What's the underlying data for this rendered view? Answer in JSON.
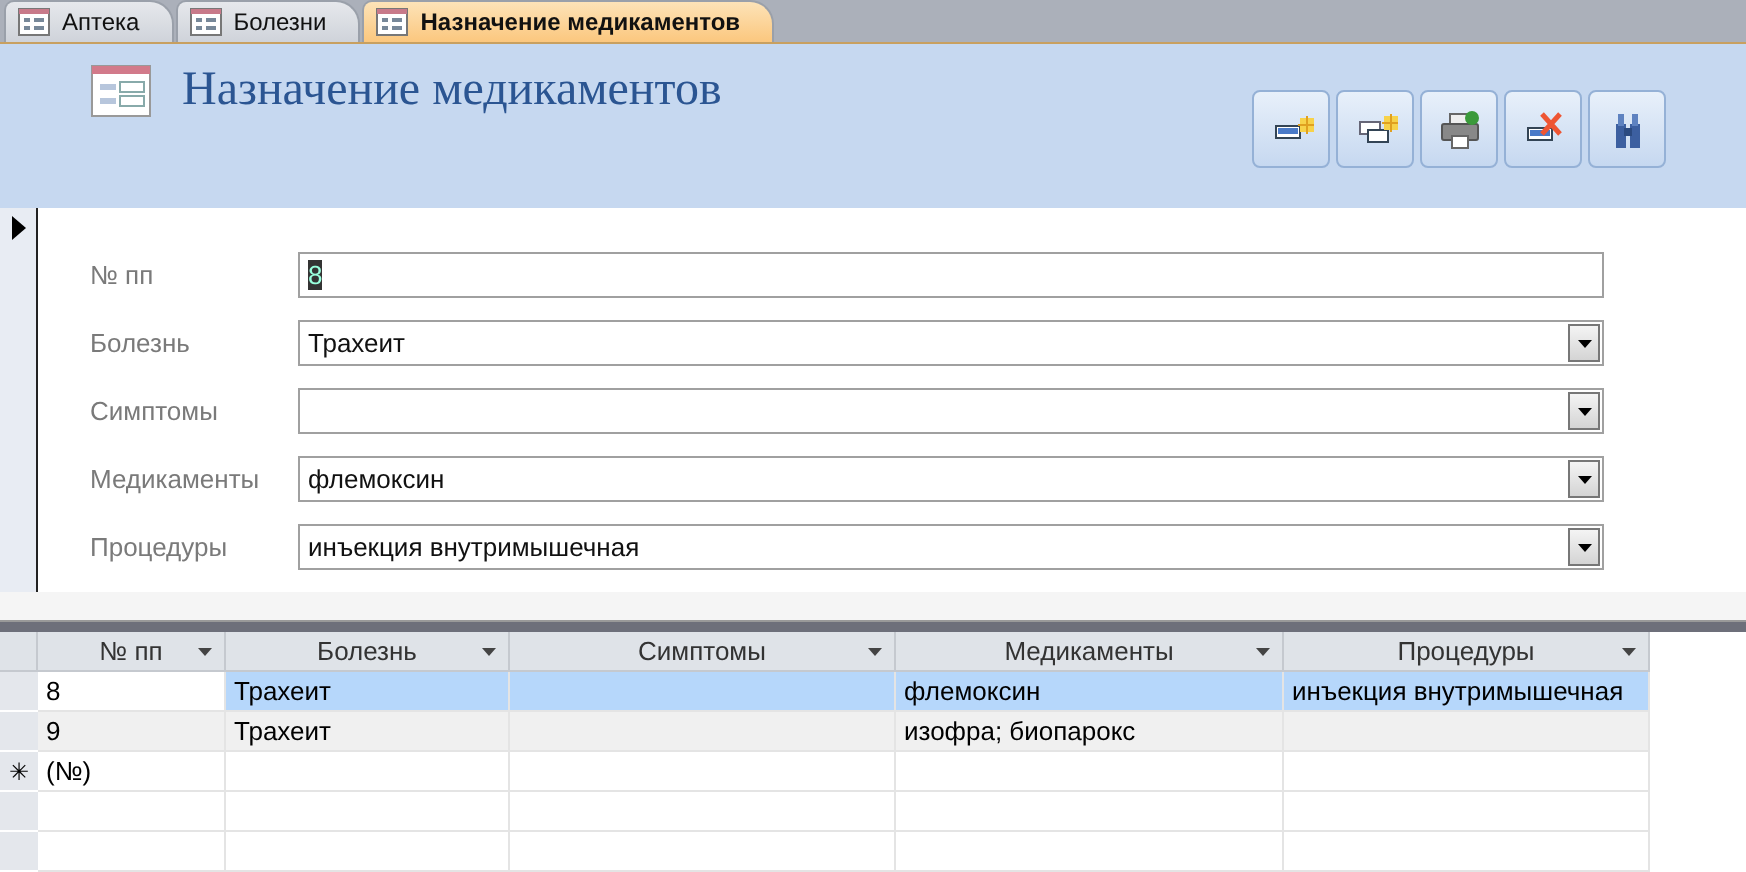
{
  "tabs": [
    {
      "label": "Аптека",
      "selected": false
    },
    {
      "label": "Болезни",
      "selected": false
    },
    {
      "label": "Назначение медикаментов",
      "selected": true
    }
  ],
  "form": {
    "title": "Назначение медикаментов",
    "current_record": true,
    "fields": [
      {
        "label": "№ пп",
        "value": "8",
        "kind": "text",
        "value_selected": true
      },
      {
        "label": "Болезнь",
        "value": "Трахеит",
        "kind": "combo"
      },
      {
        "label": "Симптомы",
        "kind": "combo"
      },
      {
        "label": "Медикаменты",
        "value": "флемоксин",
        "kind": "combo"
      },
      {
        "label": "Процедуры",
        "value": "инъекция внутримышечная",
        "kind": "combo"
      }
    ]
  },
  "table": {
    "columns": [
      "№ пп",
      "Болезнь",
      "Симптомы",
      "Медикаменты",
      "Процедуры"
    ],
    "rows": [
      {
        "kind": "record",
        "selected": true,
        "cells": [
          "8",
          "Трахеит",
          "",
          "флемоксин",
          "инъекция внутримышечная"
        ]
      },
      {
        "kind": "record",
        "selected": false,
        "cells": [
          "9",
          "Трахеит",
          "",
          "изофра; биопарокс",
          ""
        ]
      },
      {
        "kind": "new",
        "selected": false,
        "marker": "✳",
        "cells": [
          "(№)"
        ]
      }
    ]
  }
}
